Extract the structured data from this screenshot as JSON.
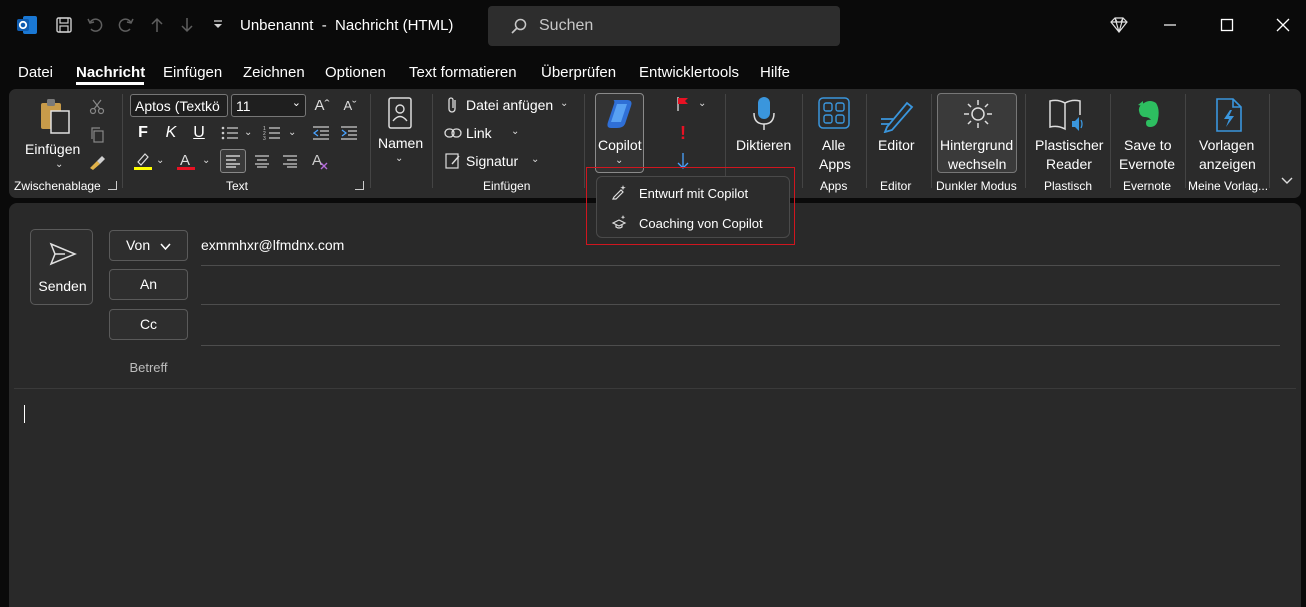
{
  "title_bar": {
    "window_title": "Unbenannt  -  Nachricht (HTML)",
    "search_placeholder": "Suchen",
    "icons": [
      "outlook-logo-icon",
      "save-icon",
      "undo-icon",
      "redo-icon",
      "up-arrow-icon",
      "down-arrow-icon",
      "customize-qat-icon",
      "diamond-icon",
      "minimize-icon",
      "maximize-icon",
      "close-icon"
    ]
  },
  "menu": {
    "tabs": [
      "Datei",
      "Nachricht",
      "Einfügen",
      "Zeichnen",
      "Optionen",
      "Text formatieren",
      "Überprüfen",
      "Entwicklertools",
      "Hilfe"
    ],
    "active": "Nachricht"
  },
  "ribbon": {
    "clipboard": {
      "paste_label": "Einfügen",
      "group_label": "Zwischenablage"
    },
    "text": {
      "font_name": "Aptos (Textkö",
      "font_size": "11",
      "bold": "F",
      "italic": "K",
      "underline": "U",
      "group_label": "Text"
    },
    "names": {
      "label": "Namen"
    },
    "insert": {
      "attach_label": "Datei anfügen",
      "link_label": "Link",
      "signature_label": "Signatur",
      "group_label": "Einfügen"
    },
    "copilot": {
      "label": "Copilot"
    },
    "dictate": {
      "label": "Diktieren"
    },
    "apps": {
      "label_line1": "Alle",
      "label_line2": "Apps",
      "group_label": "Apps"
    },
    "editor": {
      "label": "Editor",
      "group_label": "Editor"
    },
    "dark_mode": {
      "label_line1": "Hintergrund",
      "label_line2": "wechseln",
      "group_label": "Dunkler Modus"
    },
    "immersive": {
      "label_line1": "Plastischer",
      "label_line2": "Reader",
      "group_label": "Plastisch"
    },
    "evernote": {
      "label_line1": "Save to",
      "label_line2": "Evernote",
      "group_label": "Evernote"
    },
    "templates": {
      "label_line1": "Vorlagen",
      "label_line2": "anzeigen",
      "group_label": "Meine Vorlag..."
    }
  },
  "copilot_menu": {
    "items": [
      "Entwurf mit Copilot",
      "Coaching von Copilot"
    ]
  },
  "compose": {
    "send_label": "Senden",
    "from_label": "Von",
    "to_label": "An",
    "cc_label": "Cc",
    "subject_label": "Betreff",
    "from_address": "exmmhxr@lfmdnx.com"
  },
  "colors": {
    "highlight_yellow": "#ffff00",
    "font_red": "#e81123",
    "copilot_outline": "#d0161f",
    "accent_blue": "#3a96dd",
    "evernote_green": "#2dbe60"
  }
}
